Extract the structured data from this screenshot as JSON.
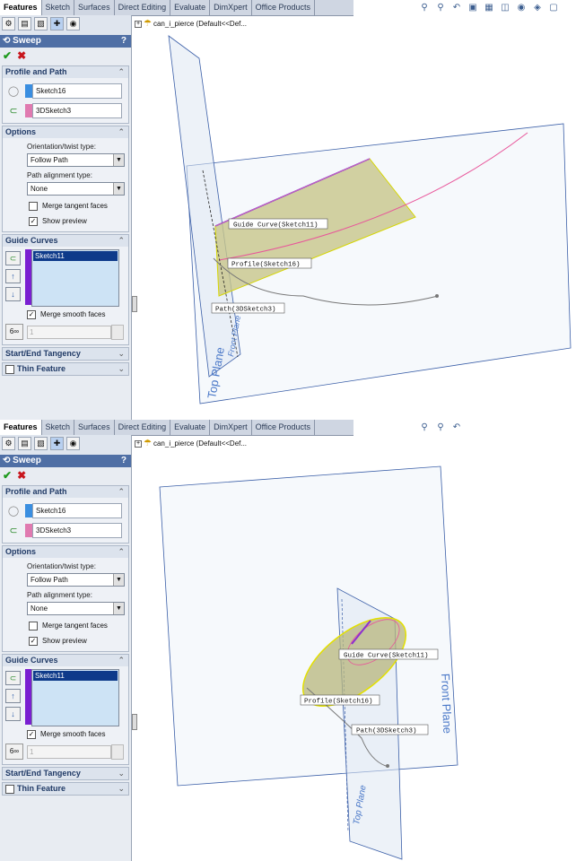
{
  "tabs": [
    "Features",
    "Sketch",
    "Surfaces",
    "Direct Editing",
    "Evaluate",
    "DimXpert",
    "Office Products"
  ],
  "feature_title": "Sweep",
  "help_label": "?",
  "profile_and_path": {
    "heading": "Profile and Path",
    "profile": "Sketch16",
    "path": "3DSketch3"
  },
  "options": {
    "heading": "Options",
    "orientation_label": "Orientation/twist type:",
    "orientation_value": "Follow Path",
    "alignment_label": "Path alignment type:",
    "alignment_value": "None",
    "merge_tangent_label": "Merge tangent faces",
    "show_preview_label": "Show preview"
  },
  "guide_curves": {
    "heading": "Guide Curves",
    "items": [
      "Sketch11"
    ],
    "merge_smooth_label": "Merge smooth faces",
    "count_value": "1"
  },
  "start_end_tangency": "Start/End Tangency",
  "thin_feature": "Thin Feature",
  "tree_label": "can_i_pierce  (Default<<Def...",
  "view1": {
    "guide_callout": "Guide Curve(Sketch11)",
    "profile_callout": "Profile(Sketch16)",
    "path_callout": "Path(3DSketch3)",
    "top_plane": "Top Plane",
    "front_plane": "Front Plane"
  },
  "view2": {
    "guide_callout": "Guide Curve(Sketch11)",
    "profile_callout": "Profile(Sketch16)",
    "path_callout": "Path(3DSketch3)",
    "top_plane": "Top Plane",
    "front_plane": "Front Plane"
  },
  "colors": {
    "panel_title": "#4f6fa5",
    "guide_bar": "#7a1fd1",
    "profile_swatch": "#3a8ee0",
    "path_swatch": "#e07ab0",
    "plane_label": "#4a78c8"
  }
}
